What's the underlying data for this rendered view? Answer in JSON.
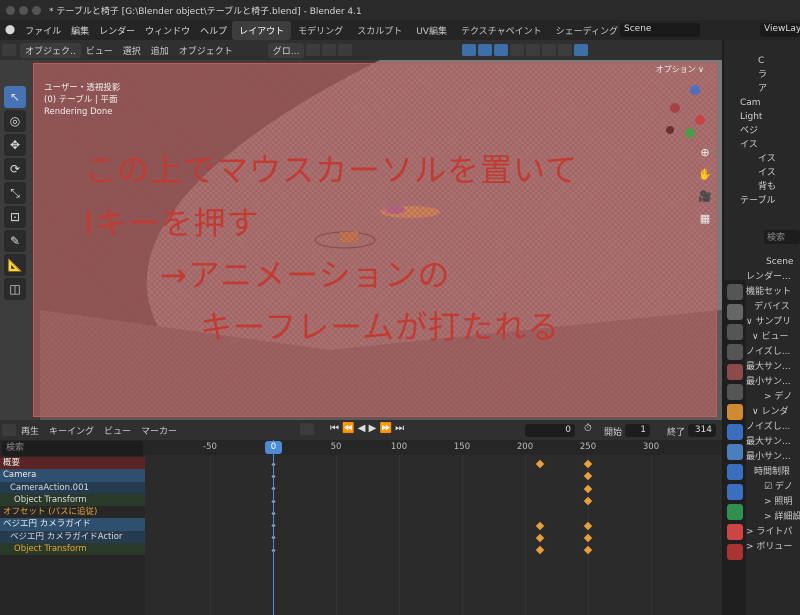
{
  "window": {
    "title": "* テーブルと椅子 [G:\\Blender object\\テーブルと椅子.blend] - Blender 4.1"
  },
  "menubar": {
    "menus": [
      "ファイル",
      "編集",
      "レンダー",
      "ウィンドウ",
      "ヘルプ"
    ],
    "workspaces": [
      "レイアウト",
      "モデリング",
      "スカルプト",
      "UV編集",
      "テクスチャペイント",
      "シェーディング"
    ],
    "scene": "Scene",
    "view_layer": "ViewLaye"
  },
  "viewport_header": {
    "mode": "オブジェク..",
    "items": [
      "ビュー",
      "選択",
      "追加",
      "オブジェクト"
    ],
    "transform": "グロ..."
  },
  "viewport": {
    "info_lines": [
      "ユーザー・透視投影",
      "(0) テーブル | 平面",
      "Rendering Done"
    ],
    "options_label": "オプション ∨",
    "annotations": [
      "この上でマウスカーソルを置いて",
      "Iキーを押す",
      "→アニメーションの",
      "キーフレームが打たれる"
    ]
  },
  "outliner": {
    "rows": [
      "C",
      "ラ",
      "ア",
      "Cam",
      "Light",
      "ベジ",
      "イス",
      "イス",
      "イス",
      "背も",
      "テーブル"
    ]
  },
  "properties": {
    "search_placeholder": "検索",
    "scene": "Scene",
    "rows": [
      "レンダー...",
      "機能セット",
      "デバイス",
      "∨ サンプリ",
      "∨ ビュー",
      "ノイズし...",
      "最大サン...",
      "最小サン...",
      "> デノ",
      "∨ レンダ",
      "ノイズし...",
      "最大サン...",
      "最小サン...",
      "時間制限",
      "☑ デノ",
      "> 照明",
      "> 詳細設",
      "> ライトパ",
      "> ボリュー"
    ]
  },
  "timeline": {
    "menus": [
      "再生",
      "キーイング",
      "ビュー",
      "マーカー"
    ],
    "current_frame": "0",
    "start_label": "開始",
    "start": "1",
    "end_label": "終了",
    "end": "314",
    "playhead_label": "0",
    "search_placeholder": "検索"
  },
  "channels": [
    {
      "label": "概要",
      "kind": "summary"
    },
    {
      "label": "Camera",
      "kind": "object"
    },
    {
      "label": "CameraAction.001",
      "kind": "action"
    },
    {
      "label": "Object Transform",
      "kind": "group"
    },
    {
      "label": "オフセット (パスに追従)",
      "kind": "orange"
    },
    {
      "label": "ベジエ円 カメラガイド",
      "kind": "object"
    },
    {
      "label": "ベジエ円 カメラガイドActior",
      "kind": "action"
    },
    {
      "label": "Object Transform",
      "kind": "group-orange"
    }
  ],
  "chart_data": {
    "type": "scatter",
    "xlabel": "",
    "ylabel": "",
    "x_ticks": [
      -50,
      0,
      50,
      100,
      150,
      200,
      250,
      300
    ],
    "xlim": [
      -100,
      325
    ],
    "keyframes": [
      {
        "channel": 0,
        "frames": [
          0,
          212,
          250
        ]
      },
      {
        "channel": 1,
        "frames": [
          0,
          250
        ]
      },
      {
        "channel": 2,
        "frames": [
          0,
          250
        ]
      },
      {
        "channel": 3,
        "frames": [
          0,
          250
        ]
      },
      {
        "channel": 4,
        "frames": [
          0
        ]
      },
      {
        "channel": 5,
        "frames": [
          0,
          212,
          250
        ]
      },
      {
        "channel": 6,
        "frames": [
          0,
          212,
          250
        ]
      },
      {
        "channel": 7,
        "frames": [
          0,
          212,
          250
        ]
      }
    ]
  },
  "colors": {
    "accent": "#4772b3",
    "keyframe": "#e8a03a",
    "annotation": "#c23b32"
  }
}
